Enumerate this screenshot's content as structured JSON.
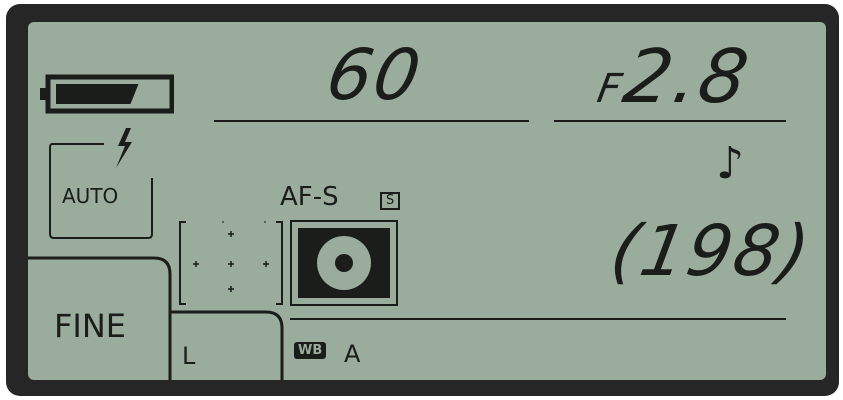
{
  "display": {
    "shutter_speed": "60",
    "aperture_prefix": "F",
    "aperture_value": "2.8",
    "flash_mode": "AUTO",
    "focus_mode": "AF-S",
    "focus_single_indicator": "S",
    "shots_remaining": "198",
    "image_quality": "FINE",
    "image_size": "L",
    "white_balance_badge": "WB",
    "white_balance": "A",
    "battery_level": 0.75
  },
  "icons": {
    "battery": "battery-icon",
    "flash": "lightning-bolt-icon",
    "beep": "music-note-icon",
    "af_area": "af-points-icon",
    "metering": "center-weighted-metering-icon"
  },
  "colors": {
    "lcd_background": "#9aac9c",
    "segment": "#1b1d1b",
    "bezel": "#262626"
  }
}
